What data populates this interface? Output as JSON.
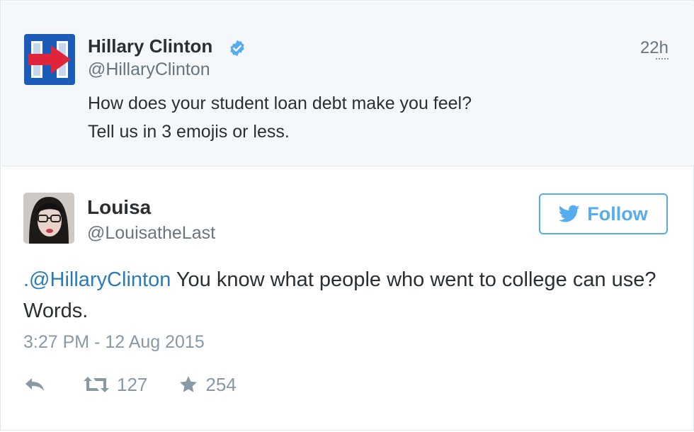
{
  "parent_tweet": {
    "author_name": "Hillary Clinton",
    "author_handle": "@HillaryClinton",
    "timestamp": "22h",
    "verified": true,
    "logo": "H-arrow-logo",
    "text_lines": [
      "How does your student loan debt make you feel?",
      "Tell us in 3 emojis or less."
    ]
  },
  "tweet": {
    "author_name": "Louisa",
    "author_handle": "@LouisatheLast",
    "follow_label": "Follow",
    "mention": ".@HillaryClinton",
    "text": " You know what people who went to college can use? Words.",
    "date": "3:27 PM - 12 Aug 2015",
    "actions": {
      "reply_icon": "reply-icon",
      "retweet_icon": "retweet-icon",
      "retweet_count": "127",
      "favorite_icon": "star-icon",
      "favorite_count": "254"
    }
  },
  "colors": {
    "link": "#2b7bb9",
    "twitter_blue": "#55acee",
    "muted": "#8899a6",
    "parent_bg": "#f5f8fa",
    "logo_blue": "#1b5cb8",
    "logo_red": "#e0253b"
  }
}
